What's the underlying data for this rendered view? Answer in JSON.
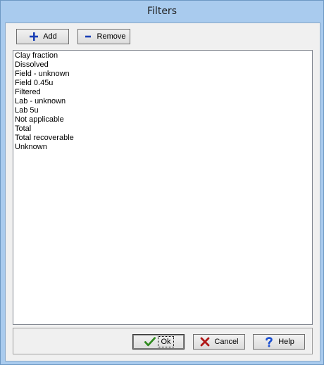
{
  "window": {
    "title": "Filters"
  },
  "toolbar": {
    "add_label": "Add",
    "remove_label": "Remove"
  },
  "filters": {
    "items": [
      "Clay fraction",
      "Dissolved",
      "Field - unknown",
      "Field 0.45u",
      "Filtered",
      "Lab - unknown",
      "Lab 5u",
      "Not applicable",
      "Total",
      "Total recoverable",
      "Unknown"
    ]
  },
  "footer": {
    "ok_label": "Ok",
    "cancel_label": "Cancel",
    "help_label": "Help"
  },
  "icons": {
    "add": "plus-icon",
    "remove": "minus-icon",
    "ok": "check-icon",
    "cancel": "x-icon",
    "help": "question-icon"
  },
  "colors": {
    "plus": "#1a3fb5",
    "minus": "#1a3fb5",
    "check": "#2f8a1e",
    "cross": "#b01818",
    "question": "#1a4fd1"
  }
}
